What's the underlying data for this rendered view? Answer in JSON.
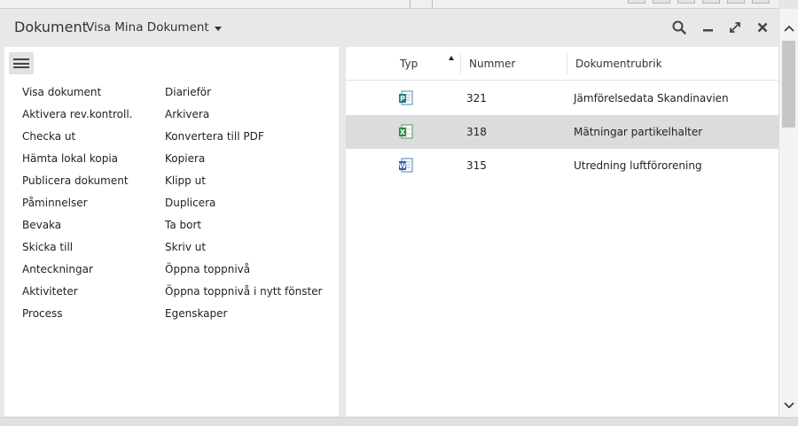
{
  "header": {
    "title": "Dokument",
    "view_selector": "Visa Mina Dokument",
    "icons": [
      "search-icon",
      "minimize-icon",
      "expand-icon",
      "close-icon"
    ]
  },
  "actions_menu": {
    "column1": [
      "Visa dokument",
      "Aktivera rev.kontroll.",
      "Checka ut",
      "Hämta lokal kopia",
      "Publicera dokument",
      "Påminnelser",
      "Bevaka",
      "Skicka till",
      "Anteckningar",
      "Aktiviteter",
      "Process"
    ],
    "column2": [
      "Diarieför",
      "Arkivera",
      "Konvertera till PDF",
      "Kopiera",
      "Klipp ut",
      "Duplicera",
      "Ta bort",
      "Skriv ut",
      "Öppna toppnivå",
      "Öppna toppnivå i nytt fönster",
      "Egenskaper"
    ]
  },
  "table": {
    "columns": [
      "Typ",
      "Nummer",
      "Dokumentrubrik"
    ],
    "sort_column": "Typ",
    "sort_direction": "ascending",
    "rows": [
      {
        "type_icon": "publisher-file-icon",
        "number": "321",
        "title": "Jämförelsedata Skandinavien",
        "selected": false
      },
      {
        "type_icon": "excel-file-icon",
        "number": "318",
        "title": "Mätningar partikelhalter",
        "selected": true
      },
      {
        "type_icon": "word-file-icon",
        "number": "315",
        "title": "Utredning luftförorening",
        "selected": false
      }
    ]
  },
  "colors": {
    "panel_bg": "#e8e8e8",
    "content_bg": "#ffffff",
    "selected_row": "#dcdcdc",
    "excel_green": "#2e8b3e",
    "word_blue": "#2f5fa8",
    "publisher_teal": "#1e7f8c"
  }
}
